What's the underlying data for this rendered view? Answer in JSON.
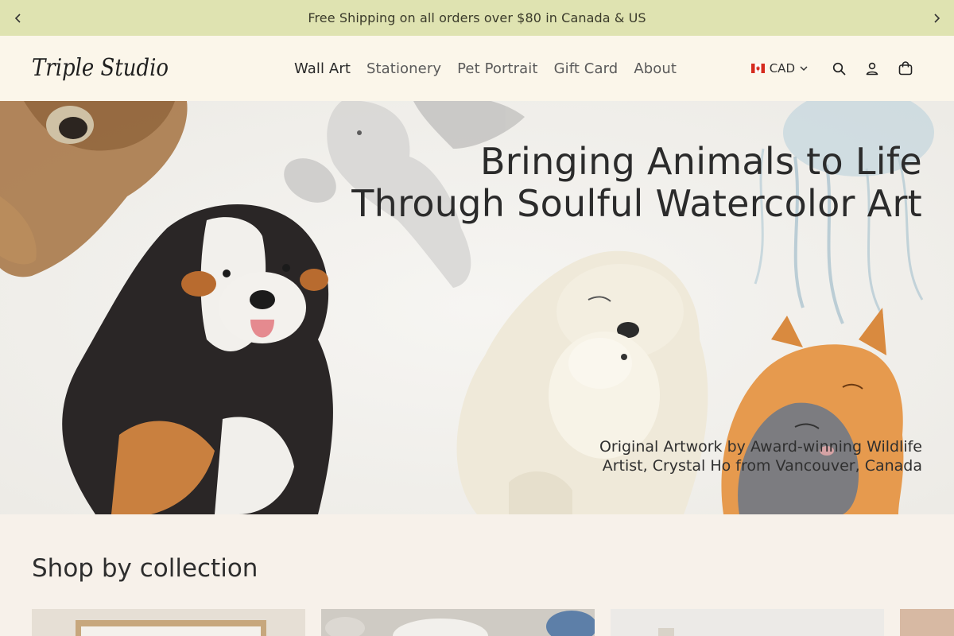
{
  "announcement": {
    "text": "Free Shipping on all orders over $80 in Canada & US"
  },
  "header": {
    "logo_text": "Triple Studio",
    "nav": [
      {
        "label": "Wall Art"
      },
      {
        "label": "Stationery"
      },
      {
        "label": "Pet Portrait"
      },
      {
        "label": "Gift Card"
      },
      {
        "label": "About"
      }
    ],
    "currency": "CAD"
  },
  "hero": {
    "title_line1": "Bringing Animals to Life",
    "title_line2": "Through Soulful Watercolor Art",
    "subtitle_line1": "Original Artwork by Award-winning Wildlife",
    "subtitle_line2": "Artist, Crystal Ho from Vancouver, Canada"
  },
  "collection": {
    "heading": "Shop by collection"
  },
  "colors": {
    "announcement_bg": "#dfe3b1",
    "header_bg": "#fbf6ea",
    "page_bg": "#f7f1ea",
    "text": "#2b2b2b"
  },
  "icons": [
    "chevron-left-icon",
    "chevron-right-icon",
    "canada-flag-icon",
    "chevron-down-icon",
    "search-icon",
    "account-icon",
    "bag-icon"
  ]
}
